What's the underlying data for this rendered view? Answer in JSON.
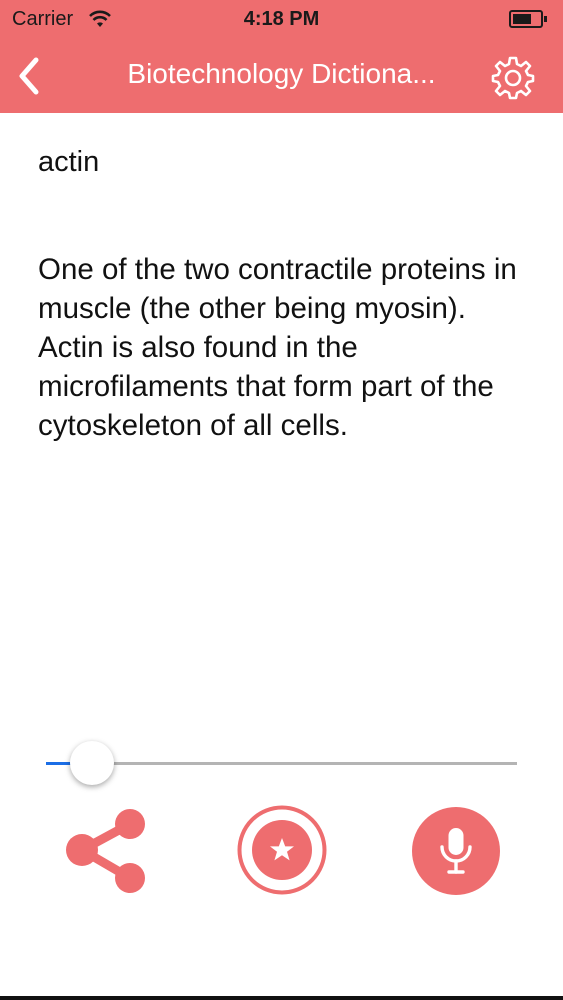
{
  "status_bar": {
    "carrier": "Carrier",
    "time": "4:18 PM",
    "battery_level": 0.65
  },
  "header": {
    "title": "Biotechnology Dictiona...",
    "back_icon": "chevron-left-icon",
    "settings_icon": "gear-icon"
  },
  "entry": {
    "term": "actin",
    "definition": "One of the two contractile proteins in muscle (the other being myosin). Actin is also found in the microfilaments that form part of the cytoskeleton of all cells."
  },
  "audio_slider": {
    "position": 0.1
  },
  "actions": {
    "share_icon": "share-icon",
    "favorite_icon": "star-icon",
    "speak_icon": "microphone-icon"
  },
  "colors": {
    "accent": "#ee6d6f",
    "slider_progress": "#1b6ee6",
    "slider_track": "#b4b4b4"
  }
}
